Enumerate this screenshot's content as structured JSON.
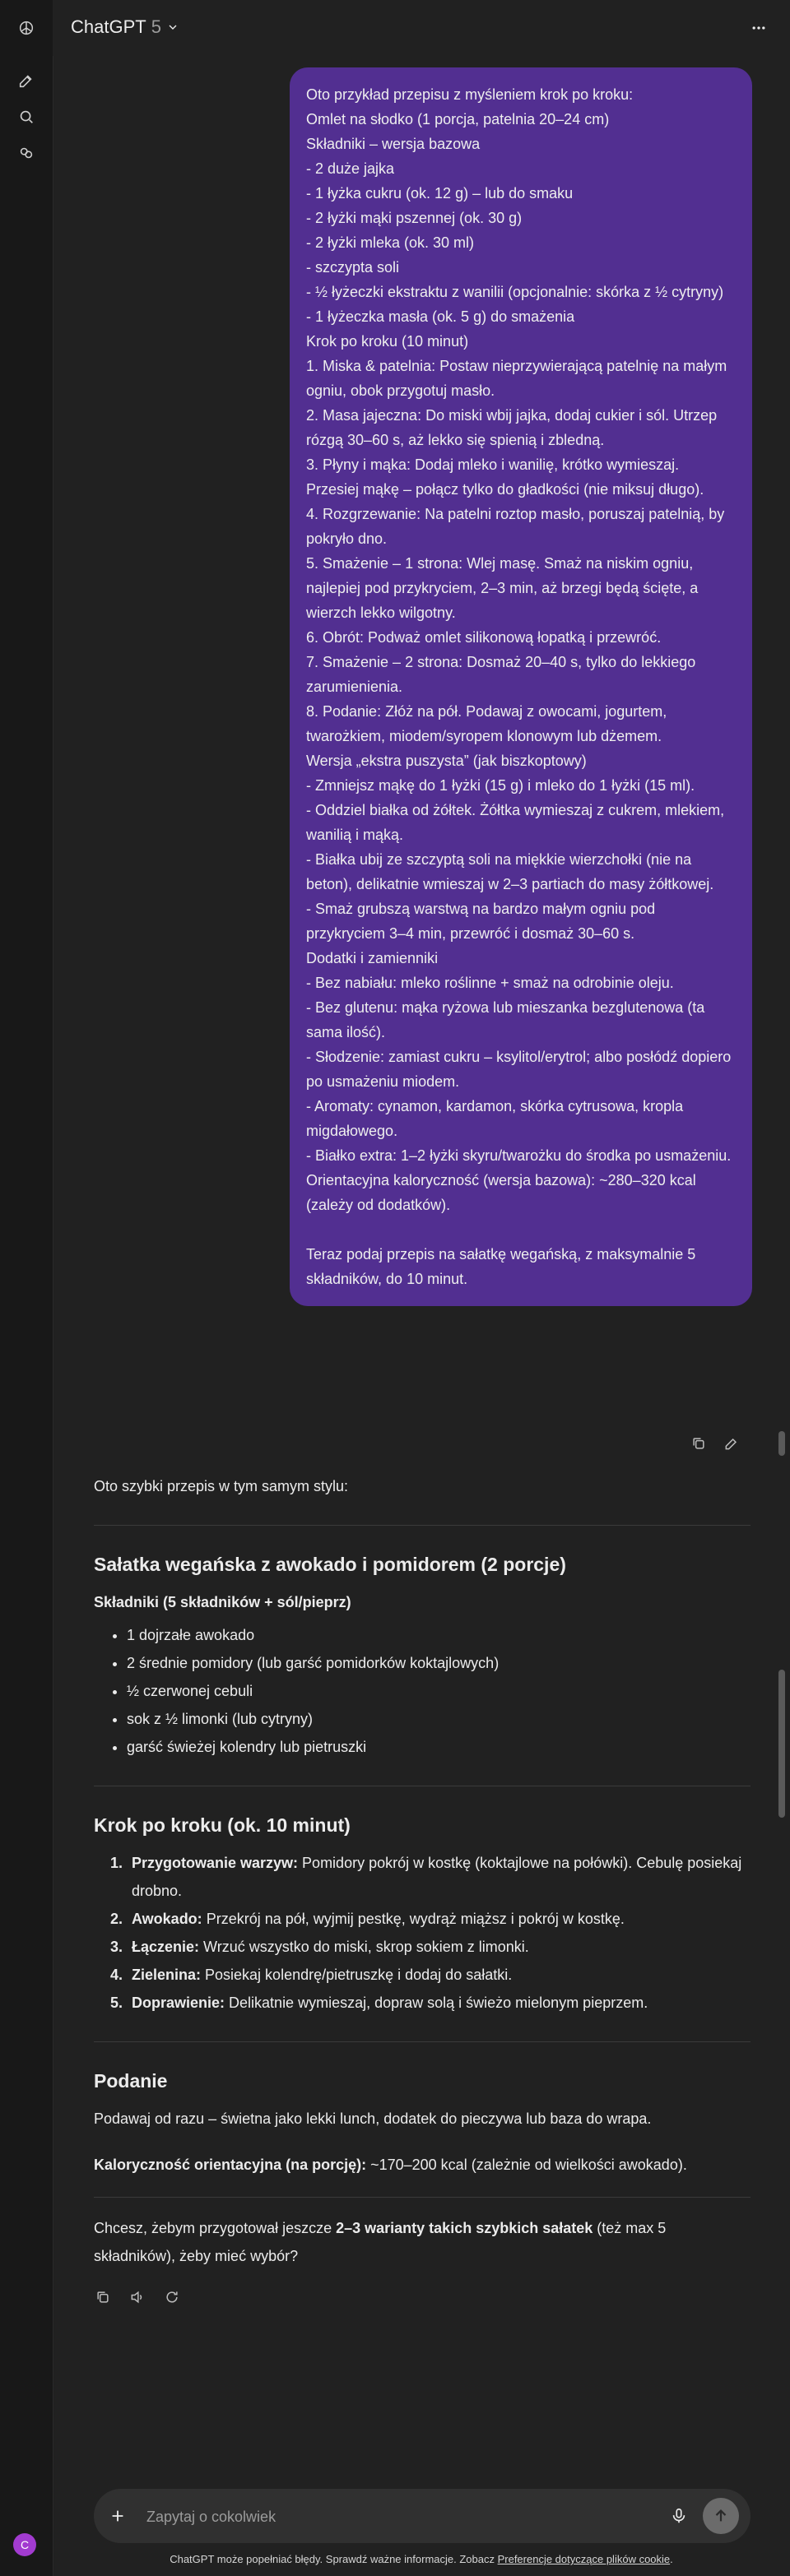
{
  "header": {
    "model_name": "ChatGPT",
    "model_version": "5"
  },
  "user_message": {
    "lines": [
      "Oto przykład przepisu z myśleniem krok po kroku:",
      "Omlet na słodko (1 porcja, patelnia 20–24 cm)",
      "Składniki – wersja bazowa",
      "- 2 duże jajka",
      "- 1 łyżka cukru (ok. 12 g) – lub do smaku",
      "- 2 łyżki mąki pszennej (ok. 30 g)",
      "- 2 łyżki mleka (ok. 30 ml)",
      "- szczypta soli",
      "- ½ łyżeczki ekstraktu z wanilii (opcjonalnie: skórka z ½ cytryny)",
      "- 1 łyżeczka masła (ok. 5 g) do smażenia",
      "Krok po kroku (10 minut)",
      "1. Miska & patelnia: Postaw nieprzywierającą patelnię na małym ogniu, obok przygotuj masło.",
      "2. Masa jajeczna: Do miski wbij jajka, dodaj cukier i sól. Utrzep rózgą 30–60 s, aż lekko się spienią i zbledną.",
      "3. Płyny i mąka: Dodaj mleko i wanilię, krótko wymieszaj. Przesiej mąkę – połącz tylko do gładkości (nie miksuj długo).",
      "4. Rozgrzewanie: Na patelni roztop masło, poruszaj patelnią, by pokryło dno.",
      "5. Smażenie – 1 strona: Wlej masę. Smaż na niskim ogniu, najlepiej pod przykryciem, 2–3 min, aż brzegi będą ścięte, a wierzch lekko wilgotny.",
      "6. Obrót: Podważ omlet silikonową łopatką i przewróć.",
      "7. Smażenie – 2 strona: Dosmaż 20–40 s, tylko do lekkiego zarumienienia.",
      "8. Podanie: Złóż na pół. Podawaj z owocami, jogurtem, twarożkiem, miodem/syropem klonowym lub dżemem.",
      "Wersja „ekstra puszysta” (jak biszkoptowy)",
      "- Zmniejsz mąkę do 1 łyżki (15 g) i mleko do 1 łyżki (15 ml).",
      "- Oddziel białka od żółtek. Żółtka wymieszaj z cukrem, mlekiem, wanilią i mąką.",
      "- Białka ubij ze szczyptą soli na miękkie wierzchołki (nie na beton), delikatnie wmieszaj w 2–3 partiach do masy żółtkowej.",
      "- Smaż grubszą warstwą na bardzo małym ogniu pod przykryciem 3–4 min, przewróć i dosmaż 30–60 s.",
      "Dodatki i zamienniki",
      "- Bez nabiału: mleko roślinne + smaż na odrobinie oleju.",
      "- Bez glutenu: mąka ryżowa lub mieszanka bezglutenowa (ta sama ilość).",
      "- Słodzenie: zamiast cukru – ksylitol/erytrol; albo posłódź dopiero po usmażeniu miodem.",
      "- Aromaty: cynamon, kardamon, skórka cytrusowa, kropla migdałowego.",
      "- Białko extra: 1–2 łyżki skyru/twarożku do środka po usmażeniu.",
      "Orientacyjna kaloryczność (wersja bazowa): ~280–320 kcal (zależy od dodatków).",
      "",
      "Teraz podaj przepis na sałatkę wegańską, z maksymalnie 5 składników, do 10 minut."
    ]
  },
  "assistant": {
    "intro": "Oto szybki przepis w tym samym stylu:",
    "title": "Sałatka wegańska z awokado i pomidorem (2 porcje)",
    "ingredients_heading": "Składniki (5 składników + sól/pieprz)",
    "ingredients": [
      "1 dojrzałe awokado",
      "2 średnie pomidory (lub garść pomidorków koktajlowych)",
      "½ czerwonej cebuli",
      "sok z ½ limonki (lub cytryny)",
      "garść świeżej kolendry lub pietruszki"
    ],
    "steps_heading": "Krok po kroku (ok. 10 minut)",
    "steps": [
      {
        "label": "Przygotowanie warzyw:",
        "text": " Pomidory pokrój w kostkę (koktajlowe na połówki). Cebulę posiekaj drobno."
      },
      {
        "label": "Awokado:",
        "text": " Przekrój na pół, wyjmij pestkę, wydrąż miąższ i pokrój w kostkę."
      },
      {
        "label": "Łączenie:",
        "text": " Wrzuć wszystko do miski, skrop sokiem z limonki."
      },
      {
        "label": "Zielenina:",
        "text": " Posiekaj kolendrę/pietruszkę i dodaj do sałatki."
      },
      {
        "label": "Doprawienie:",
        "text": " Delikatnie wymieszaj, dopraw solą i świeżo mielonym pieprzem."
      }
    ],
    "serving_heading": "Podanie",
    "serving_text": "Podawaj od razu – świetna jako lekki lunch, dodatek do pieczywa lub baza do wrapa.",
    "calories_label": "Kaloryczność orientacyjna (na porcję):",
    "calories_text": " ~170–200 kcal (zależnie od wielkości awokado).",
    "closing_pre": "Chcesz, żebym przygotował jeszcze ",
    "closing_bold": "2–3 warianty takich szybkich sałatek",
    "closing_post": " (też max 5 składników), żeby mieć wybór?"
  },
  "composer": {
    "placeholder": "Zapytaj o cokolwiek"
  },
  "footer": {
    "note": "ChatGPT może popełniać błędy. Sprawdź ważne informacje. Zobacz ",
    "link": "Preferencje dotyczące plików cookie",
    "end": "."
  },
  "user": {
    "avatar_initial": "C"
  },
  "colors": {
    "background": "#212121",
    "sidebar": "#181818",
    "user_bubble": "#522f91",
    "avatar": "#a23bd0"
  }
}
